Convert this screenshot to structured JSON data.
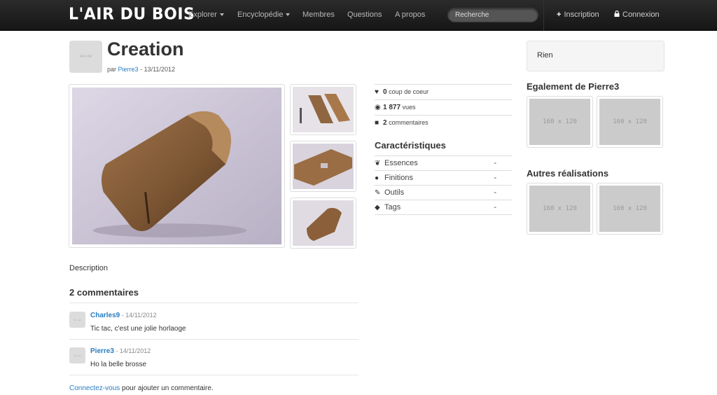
{
  "navbar": {
    "brand": "L'AIR DU BOIS",
    "items": [
      {
        "label": "Explorer",
        "dropdown": true
      },
      {
        "label": "Encyclopédie",
        "dropdown": true
      },
      {
        "label": "Membres",
        "dropdown": false
      },
      {
        "label": "Questions",
        "dropdown": false
      },
      {
        "label": "A propos",
        "dropdown": false
      }
    ],
    "search_placeholder": "Recherche",
    "signup": "Inscription",
    "login": "Connexion"
  },
  "project": {
    "avatar_label": "64 x 64",
    "title": "Creation",
    "by_prefix": "par",
    "author": "Pierre3",
    "date_sep": "-",
    "date": "13/11/2012"
  },
  "stats": [
    {
      "icon": "heart-icon",
      "value": "0",
      "label": "coup de coeur"
    },
    {
      "icon": "eye-icon",
      "value": "1 877",
      "label": "vues"
    },
    {
      "icon": "comment-icon",
      "value": "2",
      "label": "commentaires"
    }
  ],
  "characteristics": {
    "title": "Caractéristiques",
    "rows": [
      {
        "icon": "leaf-icon",
        "label": "Essences",
        "value": "-"
      },
      {
        "icon": "drop-icon",
        "label": "Finitions",
        "value": "-"
      },
      {
        "icon": "wrench-icon",
        "label": "Outils",
        "value": "-"
      },
      {
        "icon": "tags-icon",
        "label": "Tags",
        "value": "-"
      }
    ]
  },
  "sidebar": {
    "rien": "Rien",
    "also_by_title": "Egalement de Pierre3",
    "also_by": [
      "160 x 120",
      "160 x 120"
    ],
    "other_title": "Autres réalisations",
    "other": [
      "160 x 120",
      "160 x 120"
    ]
  },
  "description": "Description",
  "comments": {
    "title": "2 commentaires",
    "avatar_label": "32 x 32",
    "items": [
      {
        "author": "Charles9",
        "sep": " - ",
        "date": "14/11/2012",
        "text": "Tic tac, c'est une jolie horlaoge"
      },
      {
        "author": "Pierre3",
        "sep": " - ",
        "date": "14/11/2012",
        "text": "Ho la belle brosse"
      }
    ],
    "login_link": "Connectez-vous",
    "login_suffix": " pour ajouter un commentaire."
  },
  "colors": {
    "link": "#2a7bbf",
    "navbar": "#1b1b1b",
    "placeholder": "#cbcbcb"
  }
}
